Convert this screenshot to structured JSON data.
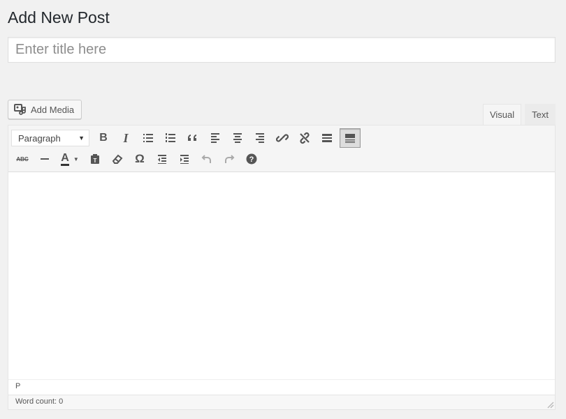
{
  "page": {
    "title": "Add New Post"
  },
  "title_field": {
    "placeholder": "Enter title here",
    "value": ""
  },
  "media": {
    "add_media_label": "Add Media"
  },
  "tabs": [
    {
      "label": "Visual",
      "active": true
    },
    {
      "label": "Text",
      "active": false
    }
  ],
  "toolbar": {
    "format_select": "Paragraph",
    "row1": [
      "bold-icon",
      "italic-icon",
      "bulleted-list-icon",
      "numbered-list-icon",
      "blockquote-icon",
      "align-left-icon",
      "align-center-icon",
      "align-right-icon",
      "insert-link-icon",
      "remove-link-icon",
      "read-more-icon",
      "toolbar-toggle-icon"
    ],
    "row2": [
      "strikethrough-icon",
      "horizontal-line-icon",
      "text-color-icon",
      "paste-as-text-icon",
      "clear-formatting-icon",
      "special-character-icon",
      "decrease-indent-icon",
      "increase-indent-icon",
      "undo-icon",
      "redo-icon",
      "keyboard-shortcuts-icon"
    ],
    "bold_glyph": "B",
    "italic_glyph": "I",
    "omega_glyph": "Ω",
    "text_color_glyph": "A",
    "strike_glyph": "ABC"
  },
  "editor": {
    "path": "P",
    "word_count": "Word count: 0"
  }
}
